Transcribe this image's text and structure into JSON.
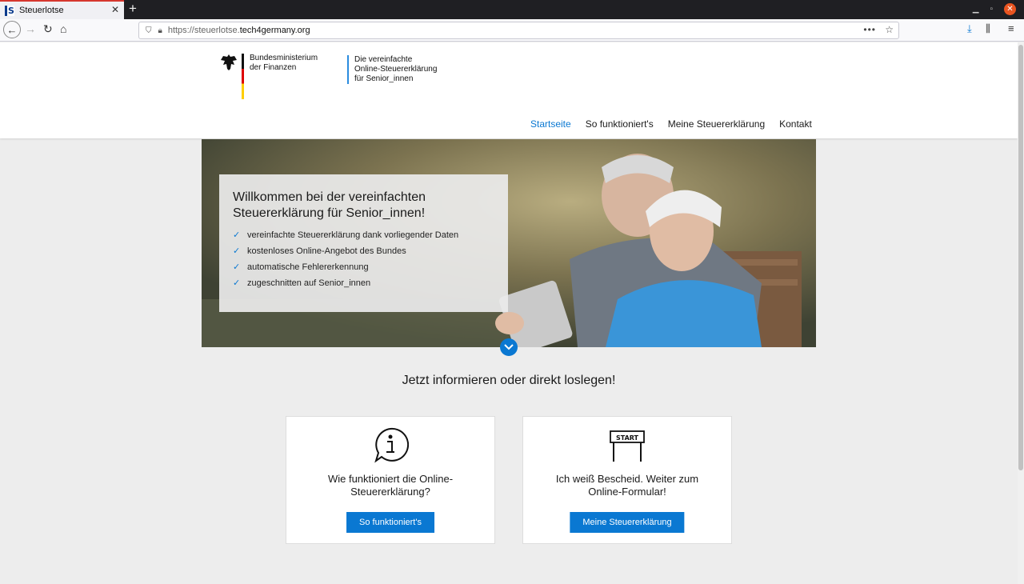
{
  "browser": {
    "tab_title": "Steuerlotse",
    "tab_favicon": "S",
    "url_prefix": "https://steuerlotse.",
    "url_domain": "tech4germany.org"
  },
  "header": {
    "ministry_line1": "Bundesministerium",
    "ministry_line2": "der Finanzen",
    "tagline_line1": "Die vereinfachte",
    "tagline_line2": "Online-Steuererklärung",
    "tagline_line3": "für Senior_innen",
    "accent_color": "#0a78d2"
  },
  "menu": {
    "items": [
      {
        "label": "Startseite",
        "active": true
      },
      {
        "label": "So funktioniert's",
        "active": false
      },
      {
        "label": "Meine Steuererklärung",
        "active": false
      },
      {
        "label": "Kontakt",
        "active": false
      }
    ]
  },
  "hero": {
    "title_line1": "Willkommen bei der vereinfachten",
    "title_line2": "Steuererklärung für Senior_innen!",
    "features": [
      "vereinfachte Steuererklärung dank vorliegender Daten",
      "kostenloses Online-Angebot des Bundes",
      "automatische Fehlererkennung",
      "zugeschnitten auf Senior_innen"
    ]
  },
  "section": {
    "title": "Jetzt informieren oder direkt loslegen!"
  },
  "cards": {
    "info": {
      "line1": "Wie funktioniert die Online-",
      "line2": "Steuererklärung?",
      "button": "So funktioniert's",
      "icon": "info-speech-bubble-icon"
    },
    "start": {
      "line1": "Ich weiß Bescheid. Weiter zum",
      "line2": "Online-Formular!",
      "button": "Meine Steuererklärung",
      "icon": "start-sign-icon",
      "sign_text": "START"
    }
  }
}
